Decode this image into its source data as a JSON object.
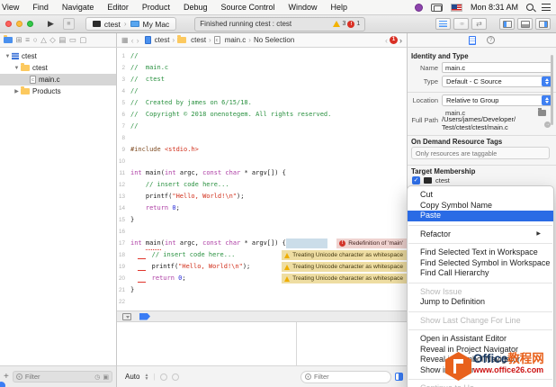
{
  "menubar": {
    "items": [
      "View",
      "Find",
      "Navigate",
      "Editor",
      "Product",
      "Debug",
      "Source Control",
      "Window",
      "Help"
    ],
    "clock": "Mon 8:31 AM"
  },
  "toolbar": {
    "scheme": "ctest",
    "destination": "My Mac",
    "status_text": "Finished running ctest : ctest",
    "warning_count": "3",
    "error_count": "1"
  },
  "navigator_bar": {
    "icons": [
      "project-navigator",
      "source-control-navigator",
      "symbol-navigator",
      "find-navigator",
      "issue-navigator",
      "test-navigator",
      "debug-navigator",
      "breakpoint-navigator",
      "report-navigator"
    ]
  },
  "jumpbar": {
    "crumbs": [
      {
        "label": "ctest",
        "icon": "project-file"
      },
      {
        "label": "ctest",
        "icon": "folder"
      },
      {
        "label": "main.c",
        "icon": "c-file"
      },
      {
        "label": "No Selection",
        "icon": ""
      }
    ],
    "issue_count": "1"
  },
  "sidebar": {
    "items": [
      {
        "label": "ctest",
        "icon": "project",
        "depth": 0,
        "disclosure": "open",
        "selected": false
      },
      {
        "label": "ctest",
        "icon": "folder",
        "depth": 1,
        "disclosure": "open",
        "selected": false
      },
      {
        "label": "main.c",
        "icon": "c-file",
        "depth": 2,
        "disclosure": "none",
        "selected": true
      },
      {
        "label": "Products",
        "icon": "folder",
        "depth": 1,
        "disclosure": "closed",
        "selected": false
      }
    ],
    "add_label": "+",
    "filter_placeholder": "Filter"
  },
  "editor": {
    "lines": [
      {
        "n": "1",
        "t": [
          [
            "cm",
            "//"
          ]
        ]
      },
      {
        "n": "2",
        "t": [
          [
            "cm",
            "//  main.c"
          ]
        ]
      },
      {
        "n": "3",
        "t": [
          [
            "cm",
            "//  ctest"
          ]
        ]
      },
      {
        "n": "4",
        "t": [
          [
            "cm",
            "//"
          ]
        ]
      },
      {
        "n": "5",
        "t": [
          [
            "cm",
            "//  Created by james on 6/15/18."
          ]
        ]
      },
      {
        "n": "6",
        "t": [
          [
            "cm",
            "//  Copyright © 2018 onenotegem. All rights reserved."
          ]
        ]
      },
      {
        "n": "7",
        "t": [
          [
            "cm",
            "//"
          ]
        ]
      },
      {
        "n": "8",
        "t": []
      },
      {
        "n": "9",
        "t": [
          [
            "pp",
            "#include"
          ],
          [
            "pl",
            " "
          ],
          [
            "st",
            "<stdio.h>"
          ]
        ]
      },
      {
        "n": "10",
        "t": []
      },
      {
        "n": "11",
        "t": [
          [
            "kw",
            "int"
          ],
          [
            "pl",
            " main("
          ],
          [
            "kw",
            "int"
          ],
          [
            "pl",
            " argc, "
          ],
          [
            "kw",
            "const"
          ],
          [
            "pl",
            " "
          ],
          [
            "kw",
            "char"
          ],
          [
            "pl",
            " * argv[]) {"
          ]
        ]
      },
      {
        "n": "12",
        "t": [
          [
            "pl",
            "    "
          ],
          [
            "cm",
            "// insert code here..."
          ]
        ]
      },
      {
        "n": "13",
        "t": [
          [
            "pl",
            "    printf("
          ],
          [
            "st",
            "\"Hello, World!\\n\""
          ],
          [
            "pl",
            ");"
          ]
        ]
      },
      {
        "n": "14",
        "t": [
          [
            "pl",
            "    "
          ],
          [
            "kw",
            "return"
          ],
          [
            "pl",
            " "
          ],
          [
            "nu",
            "0"
          ],
          [
            "pl",
            ";"
          ]
        ]
      },
      {
        "n": "15",
        "t": [
          [
            "pl",
            "}"
          ]
        ]
      },
      {
        "n": "16",
        "t": []
      },
      {
        "n": "17",
        "t": [
          [
            "kw",
            "int"
          ],
          [
            "pl",
            " "
          ],
          [
            "eu",
            "main"
          ],
          [
            "pl",
            "("
          ],
          [
            "kw",
            "int"
          ],
          [
            "pl",
            " argc, "
          ],
          [
            "kw",
            "const"
          ],
          [
            "pl",
            " "
          ],
          [
            "kw",
            "char"
          ],
          [
            "pl",
            " * argv[]) {"
          ],
          [
            "selbox",
            ""
          ]
        ],
        "banner": {
          "kind": "error",
          "text": "Redefinition of 'main'"
        }
      },
      {
        "n": "18",
        "t": [
          [
            "pl",
            "  "
          ],
          [
            "mark",
            ""
          ],
          [
            "pl",
            " "
          ],
          [
            "cm",
            "// insert code here..."
          ]
        ],
        "banner": {
          "kind": "warn",
          "text": "Treating Unicode character as whitespace"
        }
      },
      {
        "n": "19",
        "t": [
          [
            "pl",
            "  "
          ],
          [
            "mark",
            ""
          ],
          [
            "pl",
            " printf("
          ],
          [
            "st",
            "\"Hello, World!\\n\""
          ],
          [
            "pl",
            ");"
          ]
        ],
        "banner": {
          "kind": "warn",
          "text": "Treating Unicode character as whitespace"
        }
      },
      {
        "n": "20",
        "t": [
          [
            "pl",
            "  "
          ],
          [
            "mark",
            ""
          ],
          [
            "pl",
            " "
          ],
          [
            "kw",
            "return"
          ],
          [
            "pl",
            " "
          ],
          [
            "nu",
            "0"
          ],
          [
            "pl",
            ";"
          ]
        ],
        "banner": {
          "kind": "warn",
          "text": "Treating Unicode character as whitespace"
        }
      },
      {
        "n": "21",
        "t": [
          [
            "pl",
            "}"
          ]
        ]
      },
      {
        "n": "22",
        "t": []
      }
    ]
  },
  "debug_area": {
    "scope_selector": "Auto",
    "console_filter_placeholder": "Filter"
  },
  "inspector": {
    "identity_header": "Identity and Type",
    "name_label": "Name",
    "name_value": "main.c",
    "type_label": "Type",
    "type_value": "Default - C Source",
    "location_label": "Location",
    "location_value": "Relative to Group",
    "location_file": "main.c",
    "fullpath_label": "Full Path",
    "fullpath_lines": [
      "/Users/james/Developer/",
      "Test/ctest/ctest/main.c"
    ],
    "odr_header": "On Demand Resource Tags",
    "odr_placeholder": "Only resources are taggable",
    "target_header": "Target Membership",
    "target_name": "ctest"
  },
  "context_menu": {
    "items": [
      {
        "label": "Cut"
      },
      {
        "label": "Copy Symbol Name"
      },
      {
        "label": "Paste",
        "highlighted": true
      },
      {
        "type": "sep"
      },
      {
        "label": "Refactor",
        "submenu": true
      },
      {
        "type": "sep"
      },
      {
        "label": "Find Selected Text in Workspace"
      },
      {
        "label": "Find Selected Symbol in Workspace"
      },
      {
        "label": "Find Call Hierarchy"
      },
      {
        "type": "sep"
      },
      {
        "label": "Show Issue",
        "disabled": true
      },
      {
        "label": "Jump to Definition"
      },
      {
        "type": "sep"
      },
      {
        "label": "Show Last Change For Line",
        "disabled": true
      },
      {
        "type": "sep"
      },
      {
        "label": "Open in Assistant Editor"
      },
      {
        "label": "Reveal in Project Navigator"
      },
      {
        "label": "Reveal in Symbol Navigator"
      },
      {
        "label": "Show in Finder"
      },
      {
        "type": "sep"
      },
      {
        "label": "Continue to He",
        "disabled": true
      }
    ]
  },
  "watermark": {
    "name_en": "Office",
    "name_cn": "教程网",
    "url": "www.office26.com"
  }
}
